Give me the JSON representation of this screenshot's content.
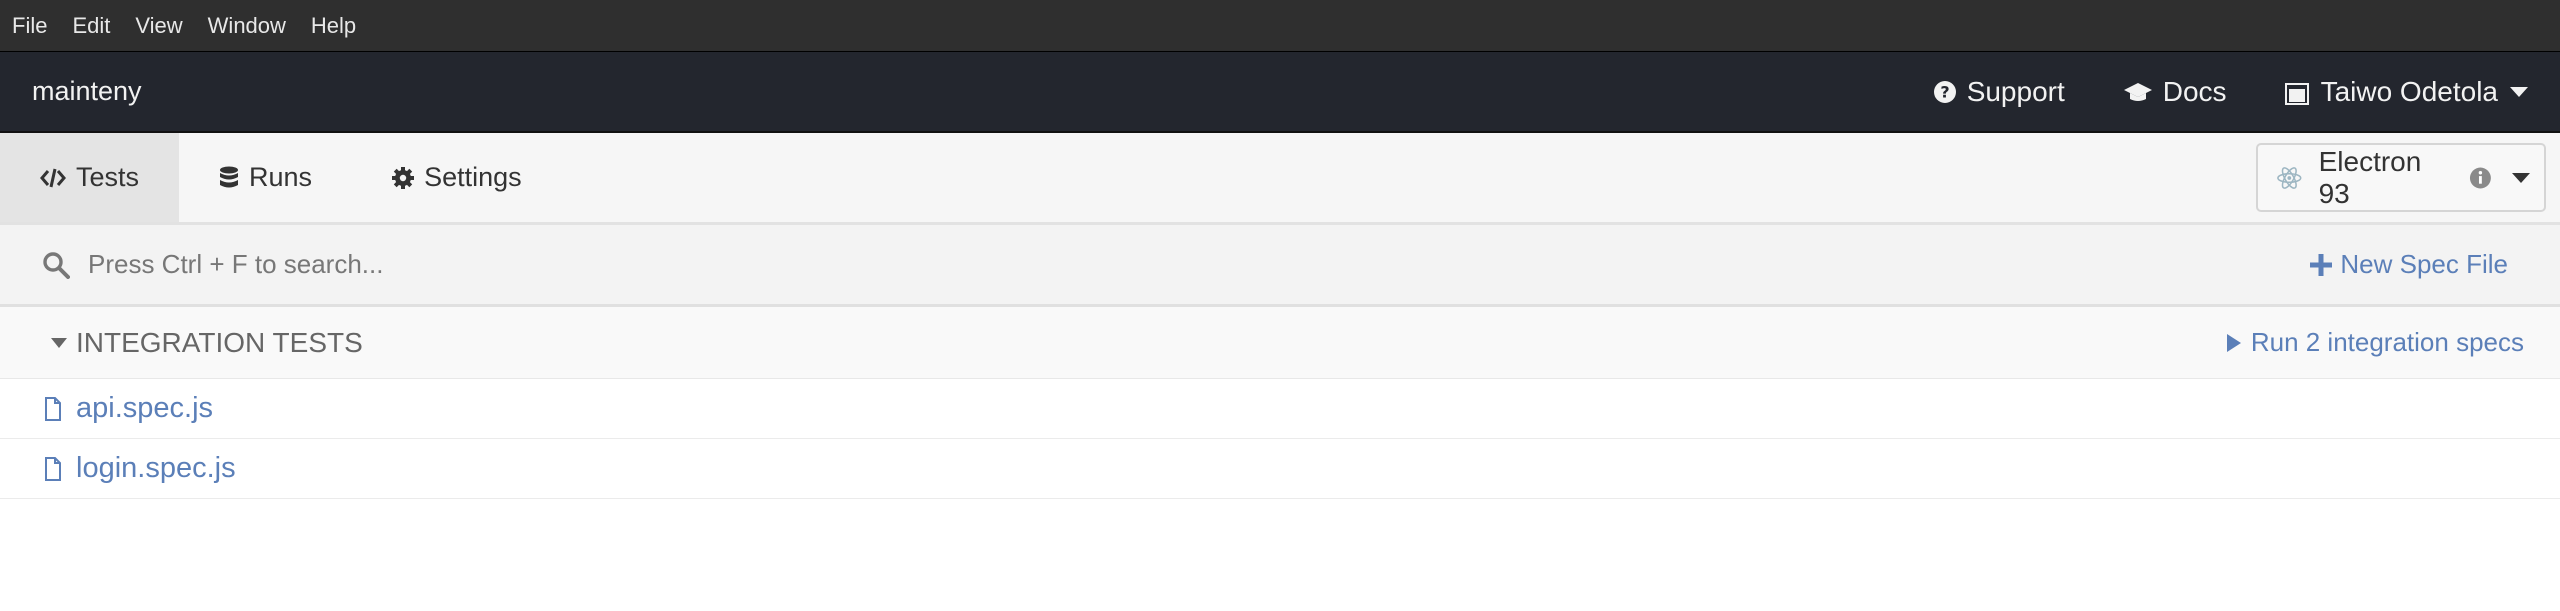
{
  "menu": [
    "File",
    "Edit",
    "View",
    "Window",
    "Help"
  ],
  "header": {
    "project": "mainteny",
    "support": "Support",
    "docs": "Docs",
    "user": "Taiwo Odetola"
  },
  "tabs": [
    {
      "label": "Tests",
      "icon": "code-icon",
      "active": true
    },
    {
      "label": "Runs",
      "icon": "database-icon",
      "active": false
    },
    {
      "label": "Settings",
      "icon": "gear-icon",
      "active": false
    }
  ],
  "browser": {
    "name": "Electron 93",
    "icon": "electron-icon"
  },
  "search": {
    "placeholder": "Press Ctrl + F to search..."
  },
  "new_spec": "New Spec File",
  "section": {
    "title": "INTEGRATION TESTS",
    "run_label": "Run 2 integration specs"
  },
  "specs": [
    "api.spec.js",
    "login.spec.js"
  ],
  "colors": {
    "link": "#5b7fb8",
    "header_bg": "#23262e",
    "menubar_bg": "#2f2f2f"
  }
}
